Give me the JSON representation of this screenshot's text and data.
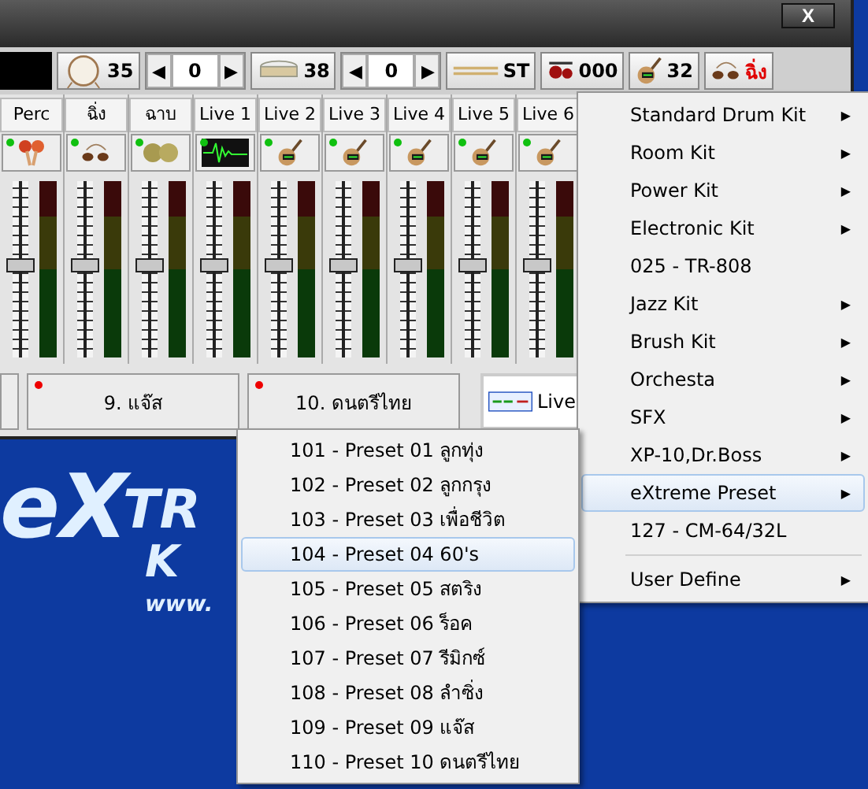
{
  "window": {
    "close": "X"
  },
  "toolbar": [
    {
      "kind": "display"
    },
    {
      "kind": "bass-drum",
      "value": "35"
    },
    {
      "kind": "spinner",
      "left": "◀",
      "value": "0",
      "right": "▶"
    },
    {
      "kind": "snare",
      "value": "38"
    },
    {
      "kind": "spinner",
      "left": "◀",
      "value": "0",
      "right": "▶"
    },
    {
      "kind": "sticks",
      "value": "ST"
    },
    {
      "kind": "drum-kit",
      "value": "000"
    },
    {
      "kind": "guitar",
      "value": "32"
    },
    {
      "kind": "finger-cymbals",
      "value": "ฉิ่ง",
      "red": true
    }
  ],
  "channels": [
    {
      "name": "Perc",
      "kind": "maracas",
      "active": true,
      "level": 0.52
    },
    {
      "name": "ฉิ่ง",
      "kind": "finger-cymbals",
      "active": true,
      "level": 0.52
    },
    {
      "name": "ฉาบ",
      "kind": "cymbals",
      "active": true,
      "level": 0.52
    },
    {
      "name": "Live 1",
      "kind": "waveform",
      "active": true,
      "level": 0.52
    },
    {
      "name": "Live 2",
      "kind": "guitar",
      "active": true,
      "level": 0.52
    },
    {
      "name": "Live 3",
      "kind": "guitar",
      "active": true,
      "level": 0.52
    },
    {
      "name": "Live 4",
      "kind": "guitar",
      "active": true,
      "level": 0.52
    },
    {
      "name": "Live 5",
      "kind": "guitar",
      "active": true,
      "level": 0.52
    },
    {
      "name": "Live 6",
      "kind": "guitar",
      "active": true,
      "level": 0.52
    }
  ],
  "styles": [
    {
      "marked": false,
      "selected": false
    },
    {
      "label": "9. แจ๊ส",
      "marked": true,
      "selected": false
    },
    {
      "label": "10. ดนตรีไทย",
      "marked": true,
      "selected": false
    },
    {
      "label": "Live",
      "marked": false,
      "selected": true
    }
  ],
  "logo": {
    "big": "eX",
    "big2": "TR",
    "small": "K",
    "url": "www."
  },
  "kit_menu": [
    {
      "label": "Standard Drum Kit",
      "arrow": "▶",
      "selected": false
    },
    {
      "label": "Room Kit",
      "arrow": "▶",
      "selected": false
    },
    {
      "label": "Power Kit",
      "arrow": "▶",
      "selected": false
    },
    {
      "label": "Electronic Kit",
      "arrow": "▶",
      "selected": false
    },
    {
      "label": "025 - TR-808",
      "selected": false
    },
    {
      "label": "Jazz Kit",
      "arrow": "▶",
      "selected": false
    },
    {
      "label": "Brush Kit",
      "arrow": "▶",
      "selected": false
    },
    {
      "label": "Orchesta",
      "arrow": "▶",
      "selected": false
    },
    {
      "label": "SFX",
      "arrow": "▶",
      "selected": false
    },
    {
      "label": "XP-10,Dr.Boss",
      "arrow": "▶",
      "selected": false
    },
    {
      "label": "eXtreme Preset",
      "arrow": "▶",
      "selected": true
    },
    {
      "label": "127 - CM-64/32L",
      "selected": false,
      "separator_after": true
    },
    {
      "label": "User Define",
      "arrow": "▶",
      "selected": false
    }
  ],
  "preset_menu": [
    {
      "label": "101 - Preset 01 ลูกทุ่ง",
      "selected": false
    },
    {
      "label": "102 - Preset 02 ลูกกรุง",
      "selected": false
    },
    {
      "label": "103 - Preset 03 เพื่อชีวิต",
      "selected": false
    },
    {
      "label": "104 - Preset 04 60's",
      "selected": true
    },
    {
      "label": "105 - Preset 05 สตริง",
      "selected": false
    },
    {
      "label": "106 - Preset 06 ร็อค",
      "selected": false
    },
    {
      "label": "107 - Preset 07 รีมิกซ์",
      "selected": false
    },
    {
      "label": "108 - Preset 08 ลำซิ่ง",
      "selected": false
    },
    {
      "label": "109 - Preset 09 แจ๊ส",
      "selected": false
    },
    {
      "label": "110 - Preset 10 ดนตรีไทย",
      "selected": false
    }
  ]
}
